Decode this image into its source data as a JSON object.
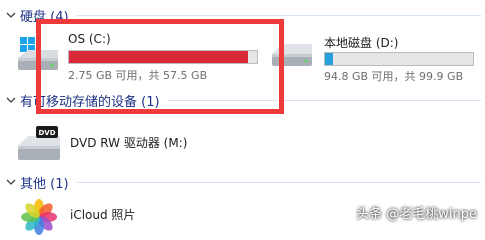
{
  "groups": {
    "hard_drives": {
      "title": "硬盘 (4)"
    },
    "removable": {
      "title": "有可移动存储的设备 (1)"
    },
    "other": {
      "title": "其他 (1)"
    }
  },
  "drives": {
    "c": {
      "name": "OS (C:)",
      "size_text": "2.75 GB 可用，共 57.5 GB",
      "used_fraction": 0.952,
      "bar_color": "#da2a3a"
    },
    "d": {
      "name": "本地磁盘 (D:)",
      "size_text": "94.8 GB 可用，共 99.9 GB",
      "used_fraction": 0.051,
      "bar_color": "#26a0da"
    }
  },
  "devices": {
    "dvd": {
      "name": "DVD RW 驱动器 (M:)",
      "icon_label": "DVD"
    },
    "icloud": {
      "name": "iCloud 照片"
    }
  },
  "watermark": "头条 @老毛桃winpe",
  "colors": {
    "highlight": "#ee3a3a",
    "group_title": "#1e3287"
  }
}
